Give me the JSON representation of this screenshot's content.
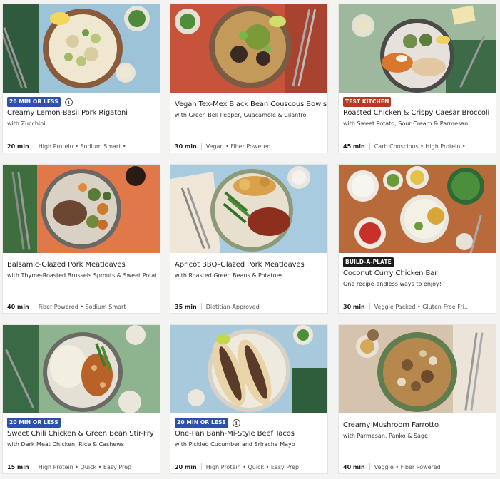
{
  "recipes": [
    {
      "badge": "20 MIN OR LESS",
      "badge_color": "#2c4fb0",
      "info": "i",
      "title": "Creamy Lemon-Basil Pork Rigatoni",
      "subtitle": "with Zucchini",
      "time": "20 min",
      "tags": "High Protein • Sodium Smart • …"
    },
    {
      "badge": "",
      "title": "Vegan Tex-Mex Black Bean Couscous Bowls",
      "subtitle": "with Green Bell Pepper, Guacamole & Cilantro",
      "time": "30 min",
      "tags": "Vegan • Fiber Powered"
    },
    {
      "badge": "TEST KITCHEN",
      "badge_color": "#b9381f",
      "title": "Roasted Chicken & Crispy Caesar Broccoli",
      "subtitle": "with Sweet Potato, Sour Cream & Parmesan",
      "time": "45 min",
      "tags": "Carb Conscious • High Protein • …"
    },
    {
      "badge": "",
      "title": "Balsamic-Glazed Pork Meatloaves",
      "subtitle": "with Thyme-Roasted Brussels Sprouts & Sweet Potat…",
      "time": "40 min",
      "tags": "Fiber Powered • Sodium Smart"
    },
    {
      "badge": "",
      "title": "Apricot BBQ–Glazed Pork Meatloaves",
      "subtitle": "with Roasted Green Beans & Potatoes",
      "time": "35 min",
      "tags": "Dietitian-Approved"
    },
    {
      "badge": "BUILD-A-PLATE",
      "badge_color": "#1c1c1c",
      "title": "Coconut Curry Chicken Bar",
      "subtitle": "One recipe-endless ways to enjoy!",
      "time": "30 min",
      "tags": "Veggie Packed • Gluten-Free Fri…"
    },
    {
      "badge": "20 MIN OR LESS",
      "badge_color": "#2c4fb0",
      "title": "Sweet Chili Chicken & Green Bean Stir-Fry",
      "subtitle": "with Dark Meat Chicken, Rice & Cashews",
      "time": "15 min",
      "tags": "High Protein • Quick • Easy Prep"
    },
    {
      "badge": "20 MIN OR LESS",
      "badge_color": "#2c4fb0",
      "info": "i",
      "title": "One-Pan Banh-Mi-Style Beef Tacos",
      "subtitle": "with Pickled Cucumber and Sriracha Mayo",
      "time": "20 min",
      "tags": "High Protein • Quick • Easy Prep"
    },
    {
      "badge": "",
      "title": "Creamy Mushroom Farrotto",
      "subtitle": "with Parmesan, Panko & Sage",
      "time": "40 min",
      "tags": "Veggie • Fiber Powered"
    }
  ]
}
